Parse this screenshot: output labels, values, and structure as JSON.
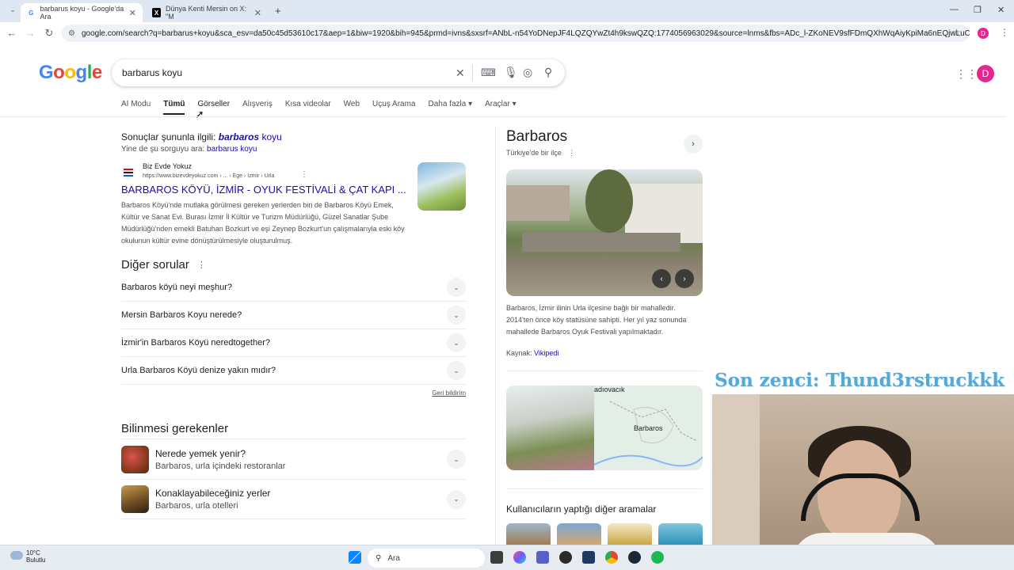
{
  "browser": {
    "tabs": [
      {
        "title": "barbarus koyu - Google'da Ara",
        "icon": "google-g-icon"
      },
      {
        "title": "Dünya Kenti Mersin on X: \"M",
        "icon": "x-logo-icon"
      }
    ],
    "new_tab": "+",
    "url": "google.com/search?q=barbarus+koyu&sca_esv=da50c45d53610c17&aep=1&biw=1920&bih=945&prmd=ivns&sxsrf=ANbL-n54YoDNepJF4LQZQYwZt4h9kswQZQ:1774056963029&source=lnms&fbs=ADc_l-ZKoNEV9sfFDmQXhWqAiyKpiMa6nEQjwLuCHfmK8fNH...",
    "profile_initial": "D"
  },
  "google": {
    "logo": "Google",
    "query": "barbarus koyu",
    "avatar": "D",
    "tabs": [
      "AI Modu",
      "Tümü",
      "Görseller",
      "Alışveriş",
      "Kısa videolar",
      "Web",
      "Uçuş Arama",
      "Daha fazla ▾",
      "Araçlar ▾"
    ],
    "active_tab": "Tümü"
  },
  "spell": {
    "prefix": "Sonuçlar şununla ilgili:",
    "corrected_bold": "barbaros",
    "corrected_rest": " koyu",
    "instead_prefix": "Yine de şu sorguyu ara:",
    "instead_query": "barbarus koyu"
  },
  "result": {
    "site": "Biz Evde Yokuz",
    "url": "https://www.bizevdeyokuz.com › ... › Ege › İzmir › Urla",
    "title": "BARBAROS KÖYÜ, İZMİR - OYUK FESTİVALİ & ÇAT KAPI ...",
    "snippet": "Barbaros Köyü'nde mutlaka görülmesi gereken yerlerden biri de Barbaros Köyü Emek, Kültür ve Sanat Evi. Burası İzmir İl Kültür ve Turizm Müdürlüğü, Güzel Sanatlar Şube Müdürlüğü'nden emekli Batuhan Bozkurt ve eşi Zeynep Bozkurt'un çalışmalarıyla eski köy okulunun kültür evine dönüştürülmesiyle oluşturulmuş."
  },
  "paa": {
    "heading": "Diğer sorular",
    "questions": [
      "Barbaros köyü neyi meşhur?",
      "Mersin Barbaros Koyu nerede?",
      "İzmir'in Barbaros Köyü neredtogether?",
      "Urla Barbaros Köyü denize yakın mıdır?"
    ],
    "feedback": "Geri bildirim"
  },
  "know": {
    "heading": "Bilinmesi gerekenler",
    "items": [
      {
        "title": "Nerede yemek yenir?",
        "subtitle": "Barbaros, urla içindeki restoranlar"
      },
      {
        "title": "Konaklayabileceğiniz yerler",
        "subtitle": "Barbaros, urla otelleri"
      }
    ]
  },
  "kp": {
    "title": "Barbaros",
    "subtitle": "Türkiye'de bir ilçe",
    "description": "Barbaros, İzmir ilinin Urla ilçesine bağlı bir mahalledir. 2014'ten önce köy statüsüne sahipti. Her yıl yaz sonunda mahallede Barbaros Oyuk Festivali yapılmaktadır.",
    "source_label": "Kaynak:",
    "source_link": "Vikipedi",
    "map_label": "Barbaros",
    "map_top_label": "adıovacık",
    "also_heading": "Kullanıcıların yaptığı diğer aramalar"
  },
  "stream": {
    "overlay": "Son zenci: Thund3rstruckkk"
  },
  "taskbar": {
    "temp": "10°C",
    "condition": "Bulutlu",
    "search_placeholder": "Ara"
  }
}
